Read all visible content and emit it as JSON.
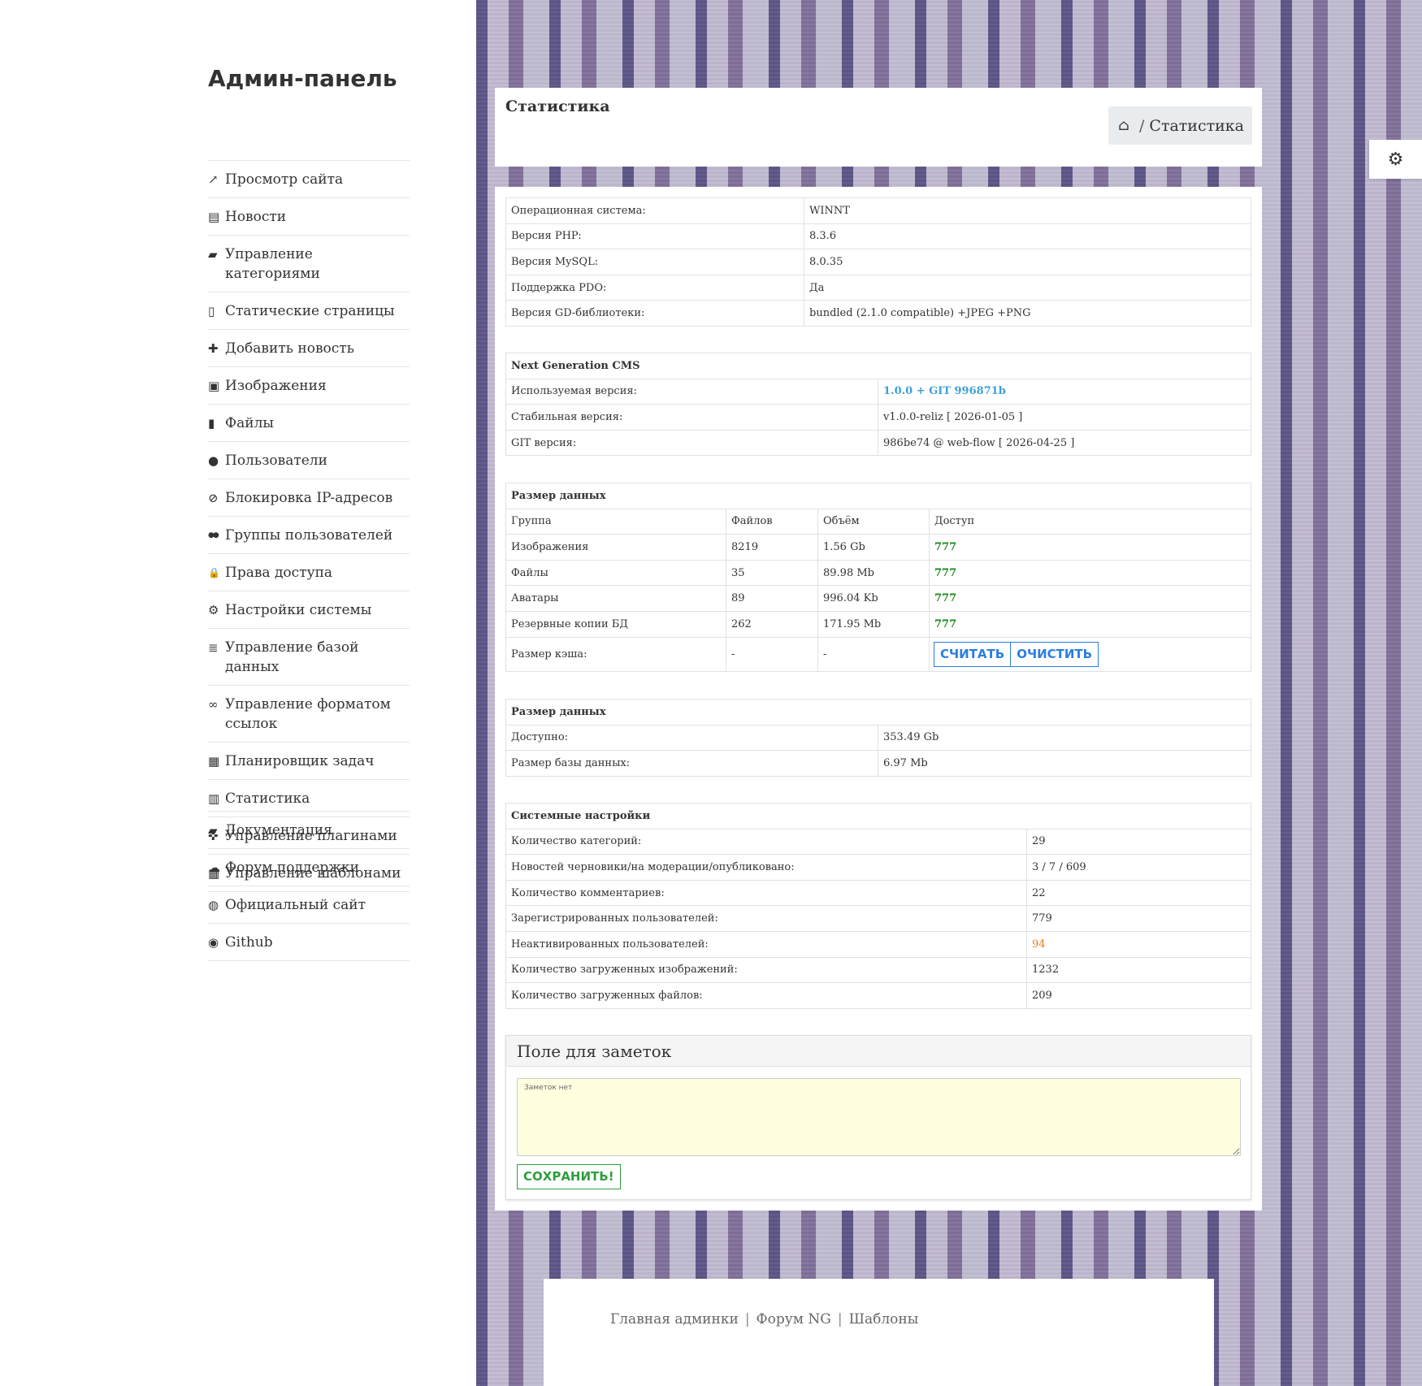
{
  "sidebar": {
    "brand": "Админ-панель",
    "items": [
      {
        "icon": "external-link-icon",
        "glyph": "↗",
        "label": "Просмотр сайта"
      },
      {
        "icon": "newspaper-icon",
        "glyph": "▤",
        "label": "Новости"
      },
      {
        "icon": "folder-open-icon",
        "glyph": "▰",
        "label": "Управление категориями"
      },
      {
        "icon": "file-text-icon",
        "glyph": "▯",
        "label": "Статические страницы"
      },
      {
        "icon": "plus-icon",
        "glyph": "✚",
        "label": "Добавить новость"
      },
      {
        "icon": "image-icon",
        "glyph": "▣",
        "label": "Изображения"
      },
      {
        "icon": "file-icon",
        "glyph": "▮",
        "label": "Файлы"
      },
      {
        "icon": "user-icon",
        "glyph": "●",
        "label": "Пользователи"
      },
      {
        "icon": "ban-icon",
        "glyph": "⊘",
        "label": "Блокировка IP-адресов"
      },
      {
        "icon": "users-icon",
        "glyph": "●●",
        "label": "Группы пользователей"
      },
      {
        "icon": "lock-icon",
        "glyph": "🔒",
        "label": "Права доступа"
      },
      {
        "icon": "cog-icon",
        "glyph": "⚙",
        "label": "Настройки системы"
      },
      {
        "icon": "database-icon",
        "glyph": "≣",
        "label": "Управление базой данных"
      },
      {
        "icon": "link-icon",
        "glyph": "∞",
        "label": "Управление форматом ссылок"
      },
      {
        "icon": "calendar-icon",
        "glyph": "▦",
        "label": "Планировщик задач"
      },
      {
        "icon": "bar-chart-icon",
        "glyph": "▥",
        "label": "Статистика"
      },
      {
        "icon": "puzzle-icon",
        "glyph": "✜",
        "label": "Управление плагинами"
      },
      {
        "icon": "th-large-icon",
        "glyph": "▦",
        "label": "Управление шаблонами"
      }
    ],
    "extra_items": [
      {
        "icon": "book-icon",
        "glyph": "▰",
        "label": "Документация"
      },
      {
        "icon": "comments-icon",
        "glyph": "☁",
        "label": "Форум поддержки"
      },
      {
        "icon": "globe-icon",
        "glyph": "◍",
        "label": "Официальный сайт"
      },
      {
        "icon": "github-icon",
        "glyph": "◉",
        "label": "Github"
      }
    ]
  },
  "header": {
    "title": "Статистика",
    "breadcrumb_home_icon": "home-icon",
    "breadcrumb_sep": "/",
    "breadcrumb_current": "Статистика"
  },
  "system": [
    {
      "label": "Операционная система:",
      "value": "WINNT"
    },
    {
      "label": "Версия PHP:",
      "value": "8.3.6"
    },
    {
      "label": "Версия MySQL:",
      "value": "8.0.35"
    },
    {
      "label": "Поддержка PDO:",
      "value": "Да"
    },
    {
      "label": "Версия GD-библиотеки:",
      "value": "bundled (2.1.0 compatible) +JPEG +PNG"
    }
  ],
  "cms": {
    "title": "Next Generation CMS",
    "rows": [
      {
        "label": "Используемая версия:",
        "value": "1.0.0 + GIT 996871b"
      },
      {
        "label": "Стабильная версия:",
        "value": "v1.0.0-reliz [ 2026-01-05 ]"
      },
      {
        "label": "GIT версия:",
        "value": "986be74 @ web-flow [ 2026-04-25 ]"
      }
    ]
  },
  "datasize": {
    "title": "Размер данных",
    "columns": [
      "Группа",
      "Файлов",
      "Объём",
      "Доступ"
    ],
    "rows": [
      {
        "group": "Изображения",
        "files": "8219",
        "size": "1.56 Gb",
        "access": "777"
      },
      {
        "group": "Файлы",
        "files": "35",
        "size": "89.98 Mb",
        "access": "777"
      },
      {
        "group": "Аватары",
        "files": "89",
        "size": "996.04 Kb",
        "access": "777"
      },
      {
        "group": "Резервные копии БД",
        "files": "262",
        "size": "171.95 Mb",
        "access": "777"
      }
    ],
    "cache": {
      "label": "Размер кэша:",
      "files": "-",
      "size": "-",
      "count_btn": "СЧИТАТЬ",
      "clear_btn": "ОЧИСТИТЬ"
    }
  },
  "disk": {
    "title": "Размер данных",
    "rows": [
      {
        "label": "Доступно:",
        "value": "353.49 Gb"
      },
      {
        "label": "Размер базы данных:",
        "value": "6.97 Mb"
      }
    ]
  },
  "settings": {
    "title": "Системные настройки",
    "rows": [
      {
        "label": "Количество категорий:",
        "value": "29"
      },
      {
        "label": "Новостей черновики/на модерации/опубликовано:",
        "value": "3 / 7 / 609"
      },
      {
        "label": "Количество комментариев:",
        "value": "22"
      },
      {
        "label": "Зарегистрированных пользователей:",
        "value": "779"
      },
      {
        "label": "Неактивированных пользователей:",
        "value": "94"
      },
      {
        "label": "Количество загруженных изображений:",
        "value": "1232"
      },
      {
        "label": "Количество загруженных файлов:",
        "value": "209"
      }
    ]
  },
  "notes": {
    "title": "Поле для заметок",
    "placeholder": "Заметок нет",
    "save_btn": "СОХРАНИТЬ!"
  },
  "footer": {
    "links": [
      "Главная админки",
      "Форум NG",
      "Шаблоны"
    ],
    "sep": "|"
  },
  "colors": {
    "accent_blue": "#2a7de1",
    "link_blue": "#3ea0d8",
    "access_green": "#1c8a1c",
    "warning_orange": "#e67e22",
    "save_green": "#2e9e3e",
    "notes_bg": "#ffffe0"
  }
}
